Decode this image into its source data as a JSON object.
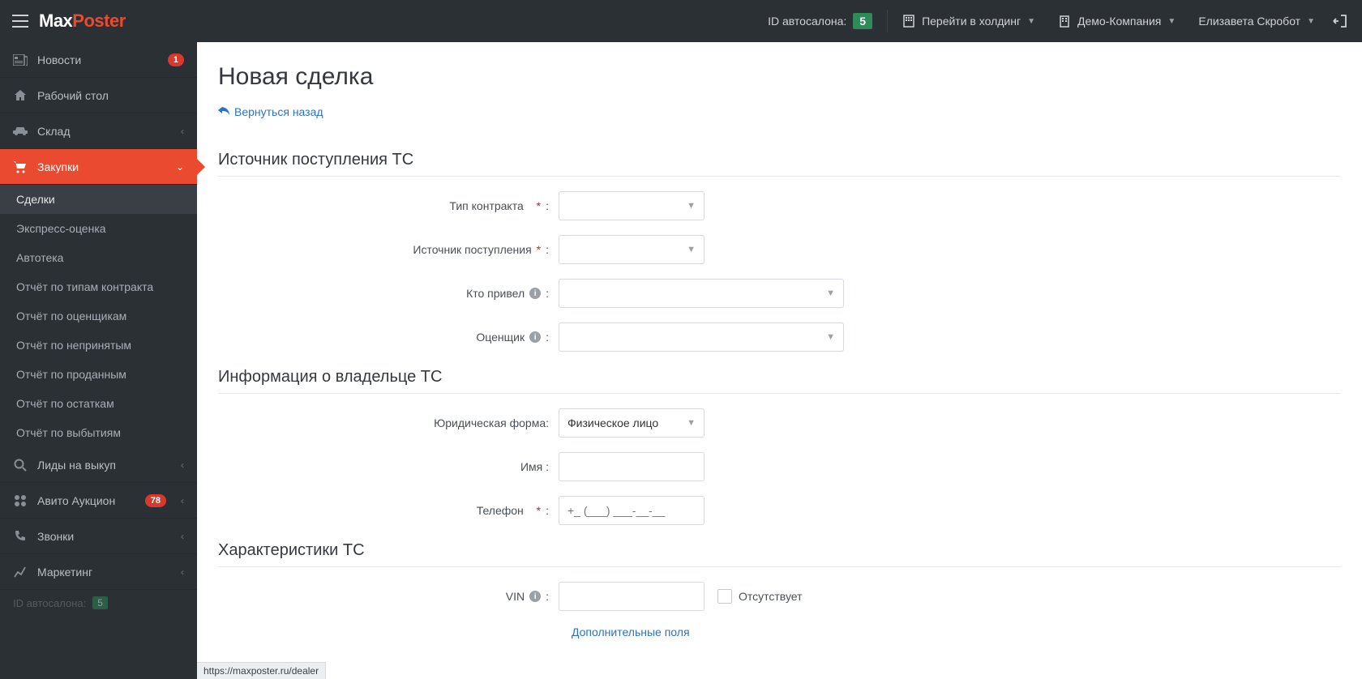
{
  "topbar": {
    "brand1": "Max",
    "brand2": "Poster",
    "id_label": "ID автосалона:",
    "id_value": "5",
    "holding": "Перейти в холдинг",
    "company": "Демо-Компания",
    "user": "Елизавета Скробот"
  },
  "sidebar": {
    "news": "Новости",
    "news_badge": "1",
    "desktop": "Рабочий стол",
    "stock": "Склад",
    "purchases": "Закупки",
    "sub": {
      "deals": "Сделки",
      "express": "Экспресс-оценка",
      "autoteka": "Автотека",
      "rep_contract": "Отчёт по типам контракта",
      "rep_appraisers": "Отчёт по оценщикам",
      "rep_rejected": "Отчёт по непринятым",
      "rep_sold": "Отчёт по проданным",
      "rep_remains": "Отчёт по остаткам",
      "rep_disposals": "Отчёт по выбытиям"
    },
    "leads": "Лиды на выкуп",
    "avito": "Авито Аукцион",
    "avito_badge": "78",
    "calls": "Звонки",
    "marketing": "Маркетинг",
    "bottom_id_label": "ID автосалона:",
    "bottom_id_value": "5"
  },
  "page": {
    "title": "Новая сделка",
    "back": "Вернуться назад",
    "sec_source": "Источник поступления ТС",
    "lbl_contract": "Тип контракта",
    "lbl_source": "Источник поступления",
    "lbl_referrer": "Кто привел",
    "lbl_appraiser": "Оценщик",
    "sec_owner": "Информация о владельце ТС",
    "lbl_legal": "Юридическая форма:",
    "val_legal": "Физическое лицо",
    "lbl_name": "Имя :",
    "lbl_phone": "Телефон",
    "phone_placeholder": "+_ (___) ___-__-__",
    "sec_chars": "Характеристики ТС",
    "lbl_vin": "VIN",
    "chk_absent": "Отсутствует",
    "extra_fields": "Дополнительные поля"
  },
  "status_url": "https://maxposter.ru/dealer"
}
